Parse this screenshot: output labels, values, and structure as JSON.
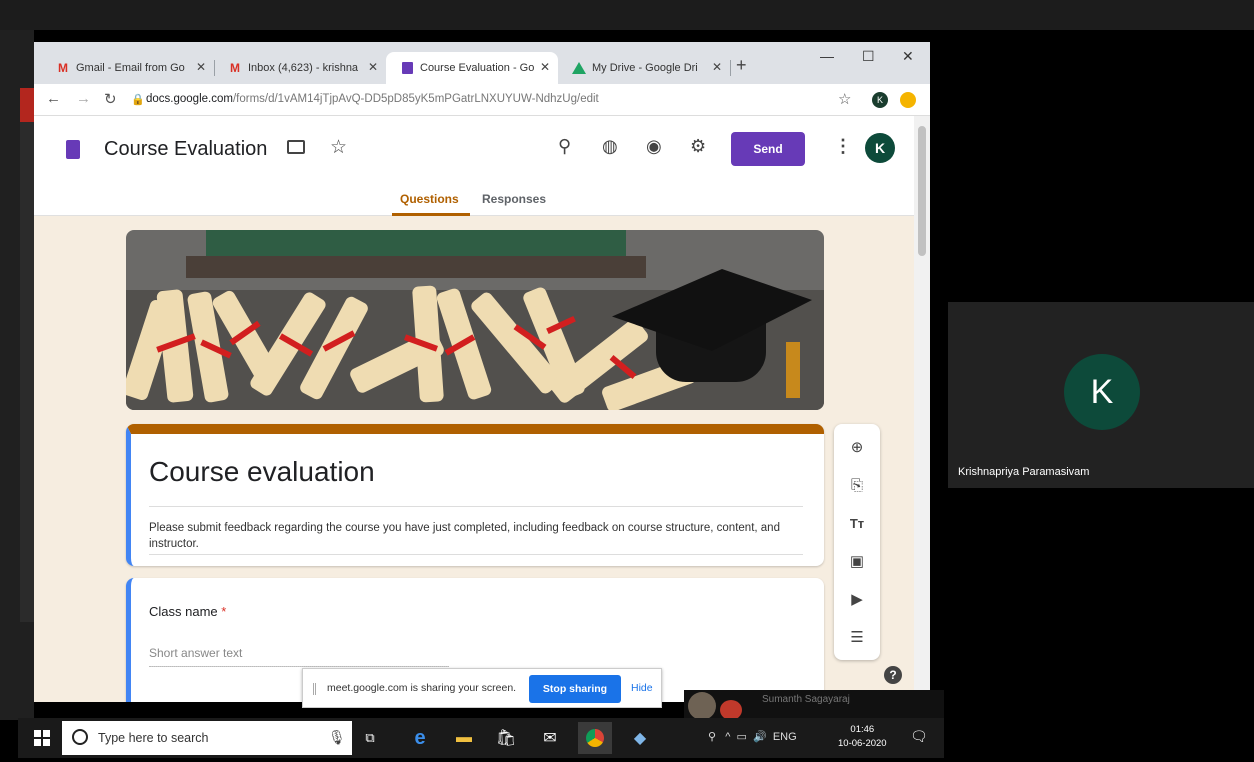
{
  "browser": {
    "tabs": [
      {
        "label": "Gmail - Email from Go",
        "icon": "gmail-icon"
      },
      {
        "label": "Inbox (4,623) - krishna",
        "icon": "gmail-icon"
      },
      {
        "label": "Course Evaluation - Go",
        "icon": "forms-icon",
        "active": true
      },
      {
        "label": "My Drive - Google Dri",
        "icon": "drive-icon"
      }
    ],
    "url_host": "docs.google.com",
    "url_path": "/forms/d/1vAM14jTjpAvQ-DD5pD85yK5mPGatrLNXUYUW-NdhzUg/edit",
    "profile_initial": "K"
  },
  "form": {
    "doc_title": "Course Evaluation",
    "send_label": "Send",
    "avatar_initial": "K",
    "tabs": {
      "questions": "Questions",
      "responses": "Responses"
    },
    "title": "Course evaluation",
    "description": "Please submit feedback regarding the course you have just completed, including feedback on course structure, content, and instructor.",
    "questions": [
      {
        "label": "Class name",
        "required_mark": "*",
        "placeholder": "Short answer text"
      }
    ],
    "help_label": "?",
    "tools": [
      "add-question-icon",
      "import-questions-icon",
      "add-title-icon",
      "add-image-icon",
      "add-video-icon",
      "add-section-icon"
    ],
    "colors": {
      "accent": "#673ab7",
      "theme": "#b06000",
      "background": "#f6ede0"
    }
  },
  "share_bar": {
    "text": "meet.google.com is sharing your screen.",
    "stop_label": "Stop sharing",
    "hide_label": "Hide"
  },
  "meet": {
    "participant_name": "Krishnapriya Paramasivam",
    "participant_initial": "K",
    "peek_name": "Sumanth Sagayaraj"
  },
  "taskbar": {
    "search_placeholder": "Type here to search",
    "language": "ENG",
    "time": "01:46",
    "date": "10-06-2020"
  }
}
